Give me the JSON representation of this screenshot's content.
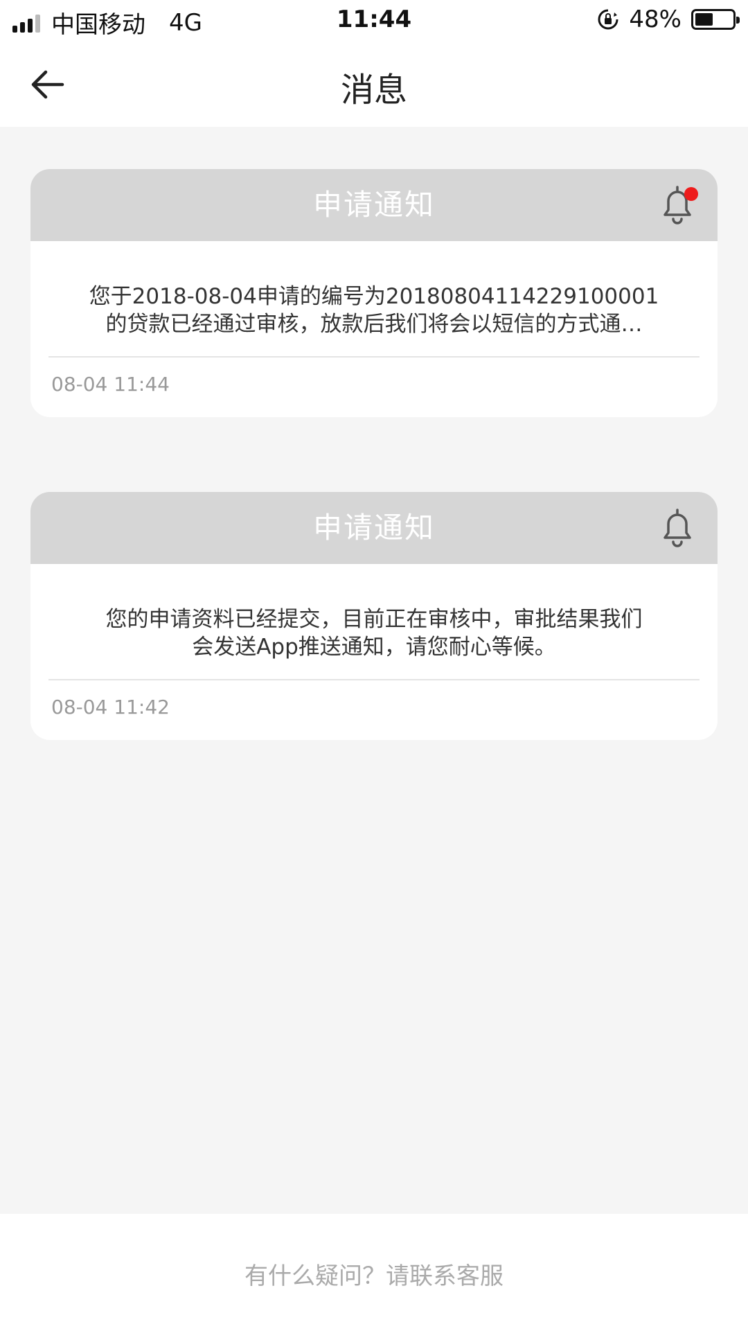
{
  "status_bar": {
    "carrier": "中国移动",
    "network": "4G",
    "time": "11:44",
    "battery_percent": "48%",
    "battery_level": 0.48
  },
  "nav": {
    "title": "消息",
    "back_icon": "arrow-left-icon"
  },
  "notifications": [
    {
      "title": "申请通知",
      "unread": true,
      "line1": "您于2018-08-04申请的编号为20180804114229100001",
      "line2": "的贷款已经通过审核，放款后我们将会以短信的方式通…",
      "time": "08-04 11:44"
    },
    {
      "title": "申请通知",
      "unread": false,
      "line1": "您的申请资料已经提交，目前正在审核中，审批结果我们",
      "line2": "会发送App推送通知，请您耐心等候。",
      "time": "08-04 11:42"
    }
  ],
  "footer": {
    "help_text": "有什么疑问？请联系客服"
  },
  "colors": {
    "card_header": "#d6d6d6",
    "unread_dot": "#ee1c1c",
    "background": "#f5f5f5"
  }
}
